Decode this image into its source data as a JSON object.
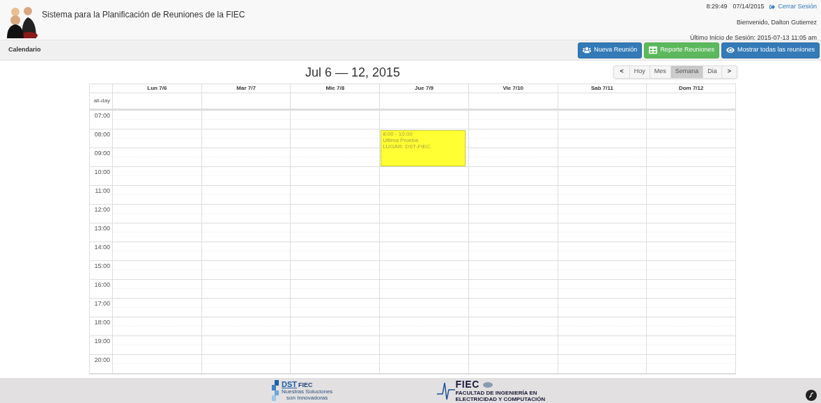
{
  "header": {
    "title": "Sistema para la Planificación de Reuniones de la FIEC",
    "time": "8:29:49",
    "date": "07/14/2015",
    "logout": "Cerrar Sesión",
    "welcome": "Bienvenido, Dalton Gutierrez",
    "last_login": "Último Inicio de Sesión: 2015-07-13 11:05 am"
  },
  "navbar": {
    "title": "Calendario",
    "buttons": [
      {
        "kind": "new",
        "label": "Nueva Reunión"
      },
      {
        "kind": "report",
        "label": "Reporte Reuniones"
      },
      {
        "kind": "all",
        "label": "Mostrar todas las reuniones"
      }
    ]
  },
  "calendar": {
    "title": "Jul 6 — 12, 2015",
    "prev": "<",
    "next": ">",
    "views": [
      {
        "label": "Hoy",
        "selected": false
      },
      {
        "label": "Mes",
        "selected": false
      },
      {
        "label": "Semana",
        "selected": true
      },
      {
        "label": "Dia",
        "selected": false
      }
    ],
    "allday_label": "all-day",
    "days": [
      {
        "label": "Lun 7/6"
      },
      {
        "label": "Mar 7/7"
      },
      {
        "label": "Mie 7/8"
      },
      {
        "label": "Jue 7/9",
        "events": [
          {
            "time": "8:00 - 10:00",
            "title": "Ultima Prueba",
            "place": "LUGAR: DST-FIEC"
          }
        ]
      },
      {
        "label": "Vie 7/10"
      },
      {
        "label": "Sab 7/11"
      },
      {
        "label": "Dom 7/12"
      }
    ],
    "hours": [
      "07:00",
      "08:00",
      "09:00",
      "10:00",
      "11:00",
      "12:00",
      "13:00",
      "14:00",
      "15:00",
      "16:00",
      "17:00",
      "18:00",
      "19:00",
      "20:00"
    ]
  },
  "footer": {
    "logos": [
      {
        "kind": "dst",
        "name": "DST",
        "brand": "FIEC",
        "lines": [
          "Nuestras Soluciones",
          "son Innovadoras"
        ]
      },
      {
        "kind": "fiec",
        "name": "FIEC",
        "lines": [
          "FACULTAD DE INGENIERÍA EN",
          "ELECTRICIDAD Y COMPUTACIÓN"
        ]
      }
    ]
  }
}
